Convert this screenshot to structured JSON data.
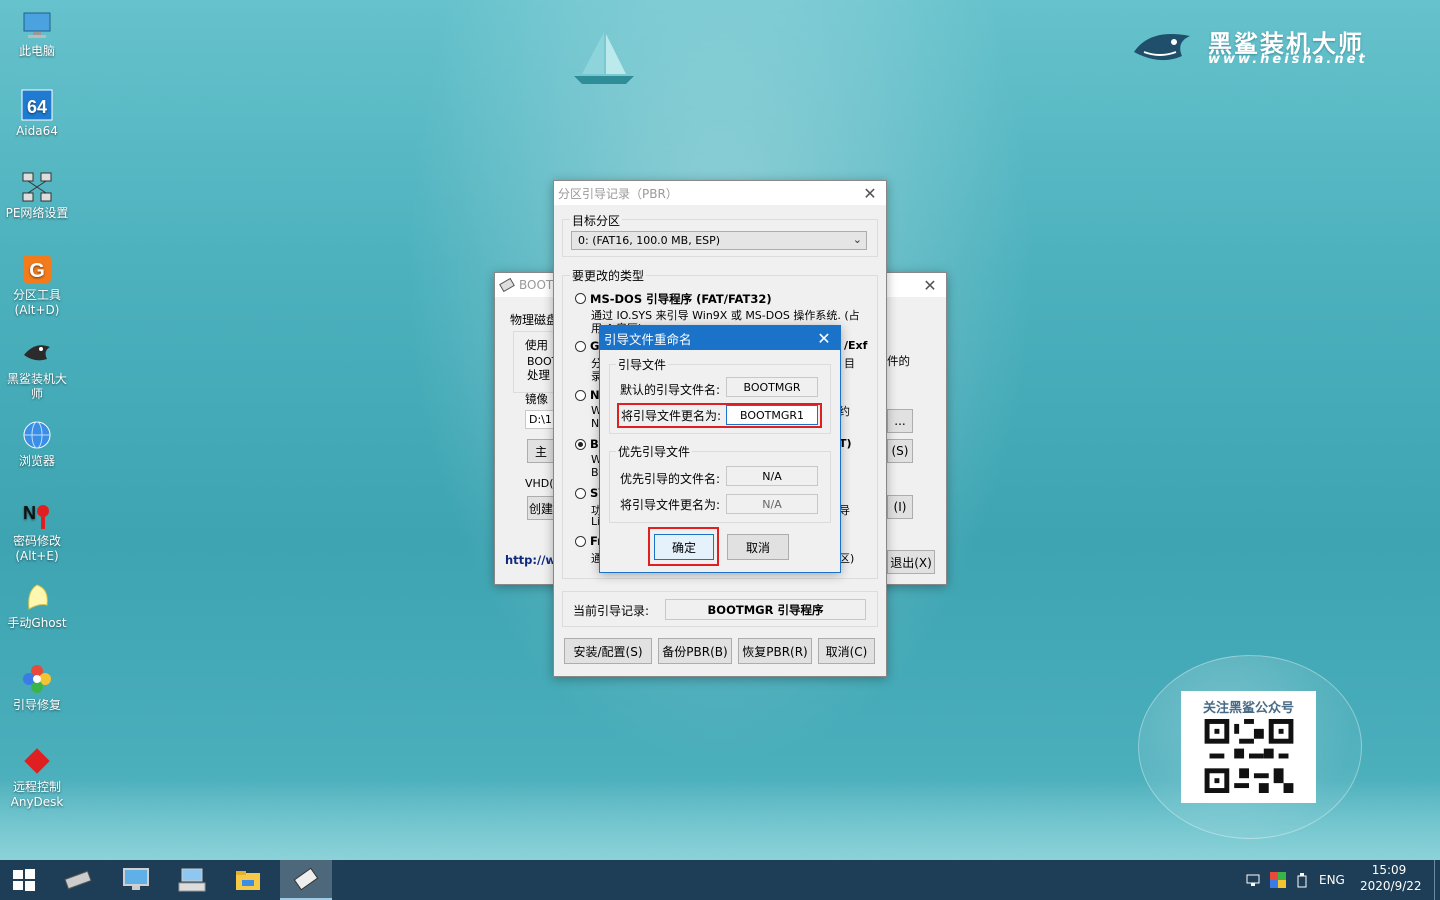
{
  "desktop": {
    "icons": [
      {
        "label": "此电脑",
        "icon": "computer-icon"
      },
      {
        "label": "Aida64",
        "icon": "aida64-icon"
      },
      {
        "label": "PE网络设置",
        "icon": "network-icon"
      },
      {
        "label": "分区工具\n(Alt+D)",
        "icon": "partition-tool-icon"
      },
      {
        "label": "黑鲨装机大师",
        "icon": "shark-icon"
      },
      {
        "label": "浏览器",
        "icon": "browser-icon"
      },
      {
        "label": "密码修改\n(Alt+E)",
        "icon": "password-icon"
      },
      {
        "label": "手动Ghost",
        "icon": "ghost-icon"
      },
      {
        "label": "引导修复",
        "icon": "boot-repair-icon"
      },
      {
        "label": "远程控制\nAnyDesk",
        "icon": "anydesk-icon"
      }
    ]
  },
  "logo": {
    "name": "黑鲨装机大师",
    "url": "www.heisha.net"
  },
  "qr": {
    "title": "关注黑鲨公众号"
  },
  "bg_window": {
    "title": "BOOT",
    "tab": "物理磁盘",
    "lines": [
      "使用",
      "BOOT",
      "处理",
      "镜像",
      "D:\\1",
      "主",
      "VHD(",
      "创建",
      "http://w"
    ],
    "right_texts": [
      "件的",
      "...",
      "(S)",
      "(I)",
      "退出(X)",
      "/Exf",
      "目",
      "约",
      "T)",
      "导",
      "区)"
    ]
  },
  "pbr_window": {
    "title": "分区引导记录（PBR）",
    "target_label": "目标分区",
    "target_value": "0: (FAT16, 100.0 MB, ESP)",
    "type_label": "要更改的类型",
    "options": [
      {
        "title": "MS-DOS 引导程序 (FAT/FAT32)",
        "desc": "通过 IO.SYS 来引导 Win9X 或 MS-DOS 操作系统. (占",
        "desc2": "用 4 扇区)",
        "checked": false
      },
      {
        "title": "Gl",
        "desc": "分",
        "desc2": "录",
        "checked": false
      },
      {
        "title": "NT",
        "desc": "W",
        "desc2": "NT",
        "checked": false
      },
      {
        "title": "Bo",
        "desc": "W",
        "desc2": "BC",
        "checked": true
      },
      {
        "title": "SY",
        "desc": "功",
        "desc2": "Li",
        "checked": false
      },
      {
        "title": "Fr",
        "desc": "通",
        "desc2": "",
        "checked": false
      }
    ],
    "current_label": "当前引导记录:",
    "current_value": "BOOTMGR 引导程序",
    "buttons": {
      "install": "安装/配置(S)",
      "backup": "备份PBR(B)",
      "restore": "恢复PBR(R)",
      "cancel": "取消(C)"
    }
  },
  "rename_dialog": {
    "title": "引导文件重命名",
    "group1": "引导文件",
    "default_label": "默认的引导文件名:",
    "default_value": "BOOTMGR",
    "rename_label": "将引导文件更名为:",
    "rename_value": "BOOTMGR1",
    "group2": "优先引导文件",
    "pref_label": "优先引导的文件名:",
    "pref_value": "N/A",
    "pref_rename_label": "将引导文件更名为:",
    "pref_rename_value": "N/A",
    "ok": "确定",
    "cancel": "取消"
  },
  "taskbar": {
    "lang": "ENG",
    "time": "15:09",
    "date": "2020/9/22"
  },
  "colors": {
    "highlight": "#e02020",
    "title_active": "#1a73c8"
  }
}
